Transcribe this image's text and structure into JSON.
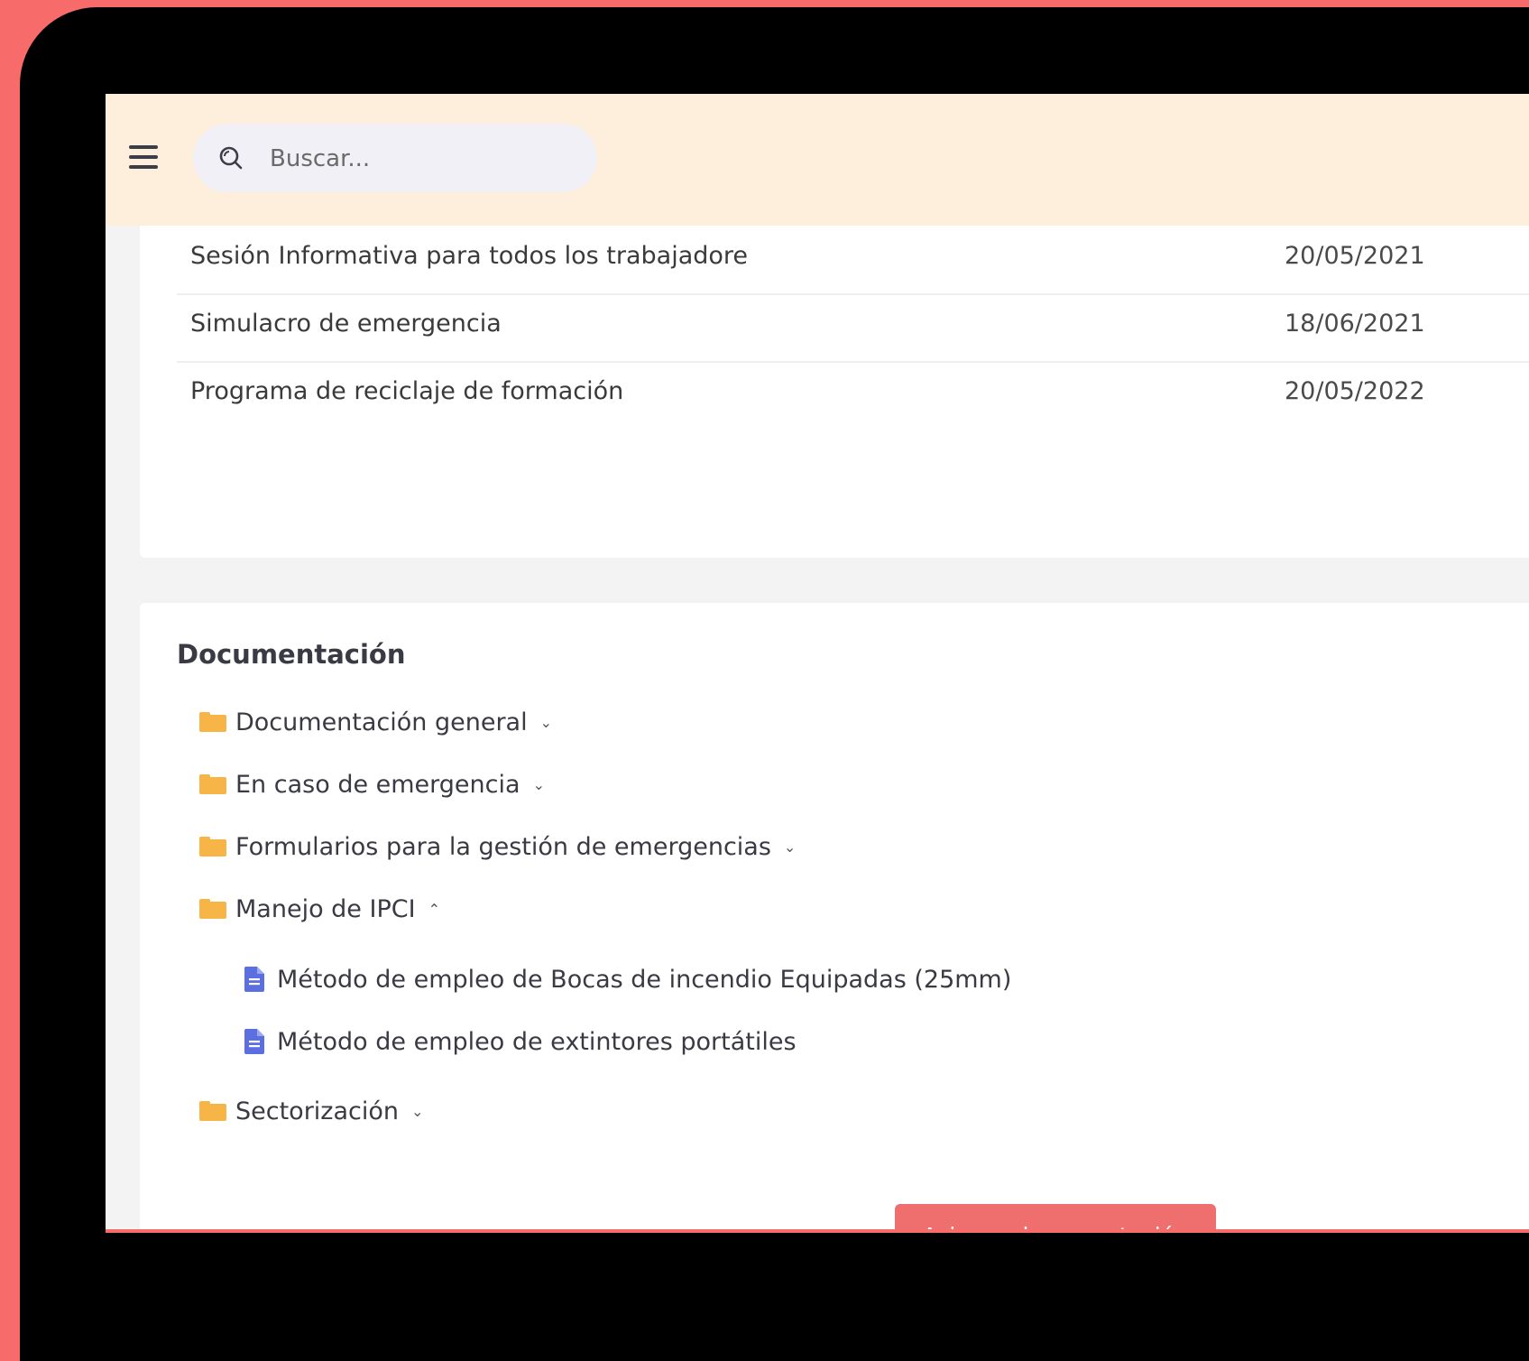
{
  "search": {
    "placeholder": "Buscar..."
  },
  "trainings": [
    {
      "name": "Sesión Informativa para todos los trabajadore",
      "date": "20/05/2021"
    },
    {
      "name": "Simulacro de emergencia",
      "date": "18/06/2021"
    },
    {
      "name": "Programa de reciclaje de formación",
      "date": "20/05/2022"
    }
  ],
  "documentation": {
    "title": "Documentación",
    "folders": [
      {
        "label": "Documentación general",
        "chevron": "⌄"
      },
      {
        "label": "En caso de emergencia",
        "chevron": "⌄"
      },
      {
        "label": "Formularios para la gestión de emergencias",
        "chevron": "⌄"
      },
      {
        "label": "Manejo de IPCI",
        "chevron": "⌃"
      },
      {
        "label": "Sectorización",
        "chevron": "⌄"
      }
    ],
    "files": [
      {
        "label": "Método de empleo de Bocas de incendio Equipadas (25mm)"
      },
      {
        "label": "Método de empleo de extintores portátiles"
      }
    ],
    "assign_button": "Asignar documentación"
  },
  "icons": {
    "menu": "hamburger-menu-icon",
    "search": "search-icon",
    "folder": "folder-icon",
    "file": "file-document-icon"
  },
  "colors": {
    "frame": "#f76b6b",
    "topbar": "#fdefdc",
    "folder": "#f7b548",
    "file": "#5b6fe0",
    "button": "#ef6f6f"
  }
}
